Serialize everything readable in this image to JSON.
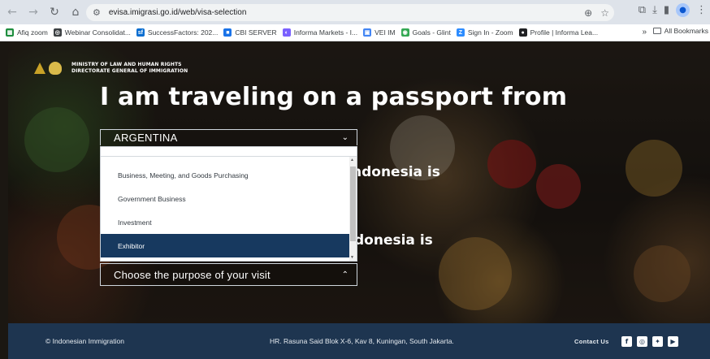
{
  "browser": {
    "url": "evisa.imigrasi.go.id/web/visa-selection",
    "bookmarks": [
      {
        "label": "Afiq zoom",
        "color": "#1e8e3e",
        "icon": "sheet-icon"
      },
      {
        "label": "Webinar Consolidat...",
        "color": "#3c4043",
        "icon": "globe-icon"
      },
      {
        "label": "SuccessFactors: 202...",
        "color": "#0a6ed1",
        "icon": "sf-icon"
      },
      {
        "label": "CBI SERVER",
        "color": "#1a73e8",
        "icon": "server-icon"
      },
      {
        "label": "Informa Markets - I...",
        "color": "#7b61ff",
        "icon": "informa-icon"
      },
      {
        "label": "VEI IM",
        "color": "#4285f4",
        "icon": "vei-icon"
      },
      {
        "label": "Goals - Glint",
        "color": "#34a853",
        "icon": "glint-icon"
      },
      {
        "label": "Sign In - Zoom",
        "color": "#2d8cff",
        "icon": "zoom-icon"
      },
      {
        "label": "Profile | Informa Lea...",
        "color": "#202124",
        "icon": "profile-icon"
      }
    ],
    "more_label": "»",
    "all_bookmarks_label": "All Bookmarks"
  },
  "header": {
    "logo_line1": "MINISTRY OF LAW AND HUMAN RIGHTS",
    "logo_line2": "DIRECTORATE GENERAL OF IMMIGRATION"
  },
  "main": {
    "headline": "I am traveling on a passport from",
    "partial_line1": "ndonesia is",
    "partial_line2": "donesia is",
    "country_select": {
      "value": "ARGENTINA"
    },
    "purpose_options": [
      "Business, Meeting, and Goods Purchasing",
      "Government Business",
      "Investment",
      "Exhibitor"
    ],
    "selected_purpose_index": 3,
    "purpose_select": {
      "placeholder": "Choose the purpose of your visit"
    }
  },
  "footer": {
    "copyright": "© Indonesian Immigration",
    "address": "HR. Rasuna Said Blok X-6, Kav 8, Kuningan, South Jakarta.",
    "contact_label": "Contact Us",
    "social": [
      "facebook-icon",
      "instagram-icon",
      "twitter-icon",
      "youtube-icon"
    ]
  },
  "colors": {
    "footer_bg": "#1e3550",
    "selected_option_bg": "#17395f"
  }
}
